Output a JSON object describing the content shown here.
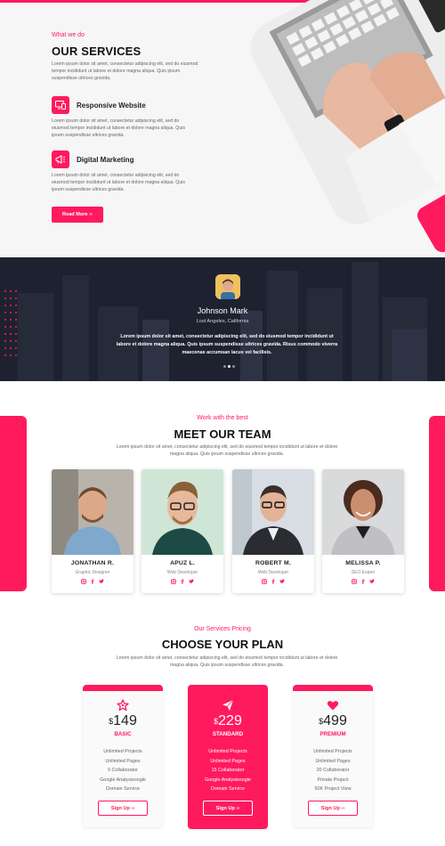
{
  "colors": {
    "accent": "#ff1a5e",
    "dark_section": "#1e2230",
    "light_section": "#f6f6f6"
  },
  "services": {
    "eyebrow": "What we do",
    "title": "OUR SERVICES",
    "intro": "Lorem ipsum dolor sit amet, consectetur adipiscing elit, sed do eiusmod tempor incididunt ut labore et dolore magna aliqua. Quis ipsum suspendisse ultrices gravida.",
    "items": [
      {
        "icon": "responsive-devices-icon",
        "title": "Responsive Website",
        "text": "Lorem ipsum dolor sit amet, consectetur adipiscing elit, sed do eiusmod tempor incididunt ut labore et dolore magna aliqua. Quis ipsum suspendisse ultrices gravida."
      },
      {
        "icon": "megaphone-icon",
        "title": "Digital Marketing",
        "text": "Lorem ipsum dolor sit amet, consectetur adipiscing elit, sed do eiusmod tempor incididunt ut labore et dolore magna aliqua. Quis ipsum suspendisse ultrices gravida."
      }
    ],
    "button_label": "Read More ››"
  },
  "testimonial": {
    "name": "Johnson Mark",
    "location": "Lost Angeles, California",
    "quote": "Lorem ipsum dolor sit amet, consectetur adipiscing elit, sed do eiusmod tempor incididunt ut labore et dolore magna aliqua. Quis ipsum suspendisse ultrices gravida. Risus commodo viverra maecenas accumsan lacus vel facilisis.",
    "active_slide": 1,
    "slide_count": 3
  },
  "team": {
    "eyebrow": "Work with the best",
    "title": "MEET OUR TEAM",
    "intro": "Lorem ipsum dolor sit amet, consectetur adipiscing elit, sed do eiusmod tempor incididunt ut labore et dolore magna aliqua. Quis ipsum suspendisse ultrices gravida.",
    "members": [
      {
        "name": "JONATHAN R.",
        "role": "Graphic Designer"
      },
      {
        "name": "APUZ L.",
        "role": "Web Developer"
      },
      {
        "name": "ROBERT M.",
        "role": "Web Developer"
      },
      {
        "name": "MELISSA P.",
        "role": "SEO Expert"
      }
    ],
    "social_icons": [
      "instagram-icon",
      "facebook-icon",
      "twitter-icon"
    ]
  },
  "pricing": {
    "eyebrow": "Our Services Pricing",
    "title": "CHOOSE YOUR PLAN",
    "intro": "Lorem ipsum dolor sit amet, consectetur adipiscing elit, sed do eiusmod tempor incididunt ut labore et dolore magna aliqua. Quis ipsum suspendisse ultrices gravida.",
    "currency": "$",
    "plans": [
      {
        "name": "BASIC",
        "price": "149",
        "icon": "star-icon",
        "featured": false,
        "features": [
          "Unlimited Projects",
          "Unlimited Pages",
          "5 Collaborator",
          "Google Analysisoogle",
          "Domain Service"
        ],
        "button_label": "Sign Up ››"
      },
      {
        "name": "STANDARD",
        "price": "229",
        "icon": "paper-plane-icon",
        "featured": true,
        "features": [
          "Unlimited Projects",
          "Unlimited Pages",
          "15 Collaborator",
          "Google Analysisoogle",
          "Domain Service"
        ],
        "button_label": "Sign Up ››"
      },
      {
        "name": "PREMIUM",
        "price": "499",
        "icon": "heart-icon",
        "featured": false,
        "features": [
          "Unlimited Projects",
          "Unlimited Pages",
          "20 Collaborator",
          "Private Project",
          "50K Project View"
        ],
        "button_label": "Sign Up ››"
      }
    ]
  }
}
